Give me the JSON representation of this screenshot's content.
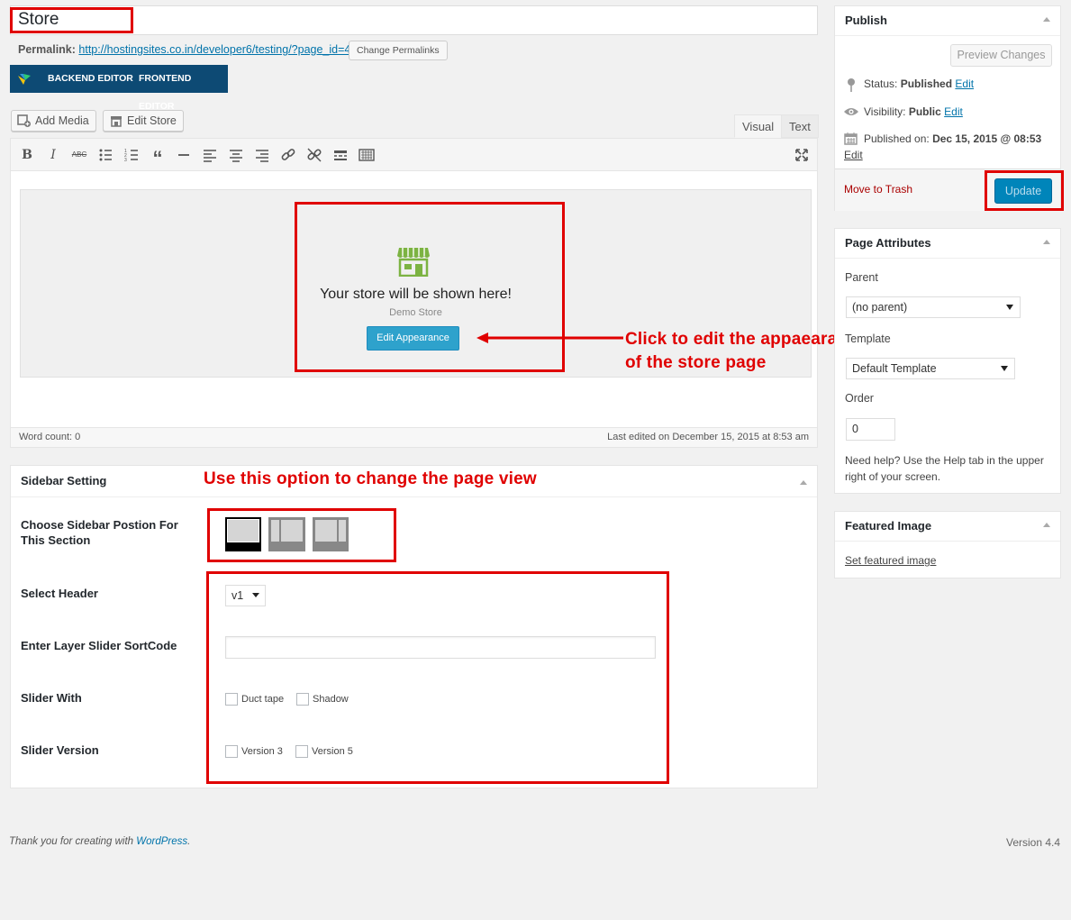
{
  "title": {
    "value": "Store"
  },
  "permalink": {
    "label": "Permalink:",
    "url": "http://hostingsites.co.in/developer6/testing/?page_id=4",
    "button": "Change Permalinks"
  },
  "vc": {
    "backend": "BACKEND EDITOR",
    "frontend": "FRONTEND EDITOR"
  },
  "media": {
    "add_media": "Add Media",
    "edit_store": "Edit Store"
  },
  "editor": {
    "tab_visual": "Visual",
    "tab_text": "Text",
    "store_text": "Your store will be shown here!",
    "demo_store": "Demo Store",
    "edit_appearance": "Edit Appearance",
    "word_count": "Word count: 0",
    "last_edited": "Last edited on December 15, 2015 at 8:53 am"
  },
  "annotations": {
    "click_line1": "Click to edit the appaearance",
    "click_line2": "of the store page",
    "use_option": "Use this option to change the page view"
  },
  "sidebar_setting": {
    "title": "Sidebar Setting",
    "choose_label": "Choose Sidebar Postion For This Section",
    "header_label": "Select Header",
    "header_value": "v1",
    "layer_label": "Enter Layer Slider SortCode",
    "layer_value": "",
    "slider_with_label": "Slider With",
    "slider_with_options": [
      "Duct tape",
      "Shadow"
    ],
    "slider_version_label": "Slider Version",
    "slider_version_options": [
      "Version 3",
      "Version 5"
    ]
  },
  "publish": {
    "title": "Publish",
    "preview": "Preview Changes",
    "status_label": "Status:",
    "status_value": "Published",
    "visibility_label": "Visibility:",
    "visibility_value": "Public",
    "published_label": "Published on:",
    "published_value": "Dec 15, 2015 @ 08:53",
    "edit": "Edit",
    "trash": "Move to Trash",
    "update": "Update"
  },
  "page_attributes": {
    "title": "Page Attributes",
    "parent_label": "Parent",
    "parent_value": "(no parent)",
    "template_label": "Template",
    "template_value": "Default Template",
    "order_label": "Order",
    "order_value": "0",
    "help": "Need help? Use the Help tab in the upper right of your screen."
  },
  "featured_image": {
    "title": "Featured Image",
    "link": "Set featured image"
  },
  "footer": {
    "thanks": "Thank you for creating with ",
    "wp": "WordPress",
    "period": ".",
    "version": "Version 4.4"
  },
  "colors": {
    "accent": "#0073aa",
    "annotation": "#e00000",
    "vc_bar": "#0d4a74",
    "update_button": "#0085ba"
  }
}
